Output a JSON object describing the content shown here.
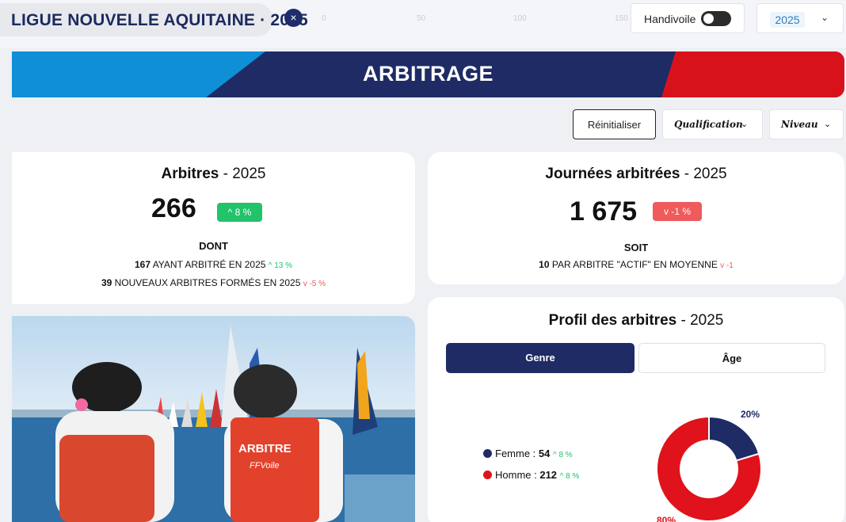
{
  "header": {
    "league_title": "LIGUE NOUVELLE AQUITAINE · 2025",
    "close_icon": "×",
    "ghost_ticks": [
      "0",
      "50",
      "100",
      "150"
    ],
    "handivoile_label": "Handivoile",
    "handivoile_on": false,
    "year_selected": "2025"
  },
  "banner": {
    "title": "ARBITRAGE",
    "colors": {
      "left": "#0e8fd6",
      "center": "#1e2b65",
      "right": "#d8121b"
    }
  },
  "filters": {
    "reset_label": "Réinitialiser",
    "qualification_label": "Qualification",
    "niveau_label": "Niveau"
  },
  "arbitres": {
    "title": "Arbitres",
    "year": " - 2025",
    "value": "266",
    "badge": "^ 8 %",
    "dont": "DONT",
    "line1_num": "167",
    "line1_text": " AYANT ARBITRÉ EN 2025 ",
    "line1_delta": "^ 13 %",
    "line2_num": "39",
    "line2_text": " NOUVEAUX ARBITRES FORMÉS EN 2025 ",
    "line2_delta": "v -5 %"
  },
  "journees": {
    "title": "Journées arbitrées",
    "year": " - 2025",
    "value": "1 675",
    "badge": "v -1 %",
    "soit": "SOIT",
    "line1_num": "10",
    "line1_text": " PAR ARBITRE \"ACTIF\" EN MOYENNE ",
    "line1_delta": "v -1"
  },
  "photo": {
    "vest_text": "ARBITRE",
    "vest_logo": "FFVoile"
  },
  "profil": {
    "title": "Profil des arbitres",
    "year": " - 2025",
    "tab_genre": "Genre",
    "tab_age": "Âge",
    "femme_label": "Femme : ",
    "femme_value": "54",
    "femme_delta": "^ 8 %",
    "homme_label": "Homme : ",
    "homme_value": "212",
    "homme_delta": "^ 8 %",
    "pct_femme": "20%",
    "pct_homme": "80%",
    "colors": {
      "femme": "#1e2b65",
      "homme": "#e0121b"
    }
  },
  "chart_data": {
    "type": "pie",
    "categories": [
      "Femme",
      "Homme"
    ],
    "values": [
      54,
      212
    ],
    "percent_labels": [
      "20%",
      "80%"
    ]
  }
}
